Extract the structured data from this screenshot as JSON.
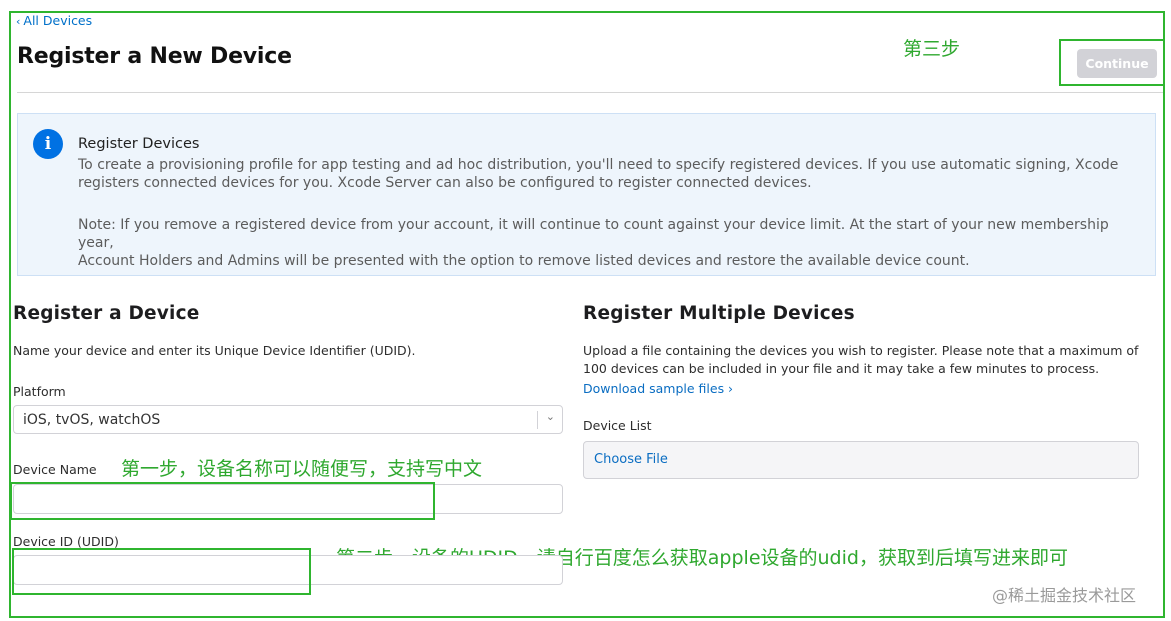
{
  "nav": {
    "back_label": "All Devices"
  },
  "header": {
    "title": "Register a New Device",
    "continue_label": "Continue"
  },
  "info": {
    "title": "Register Devices",
    "p1_line1": "To create a provisioning profile for app testing and ad hoc distribution, you'll need to specify registered devices. If you use automatic signing, Xcode",
    "p1_line2": "registers connected devices for you. Xcode Server can also be configured to register connected devices.",
    "p2_line1": "Note: If you remove a registered device from your account, it will continue to count against your device limit. At the start of your new membership year,",
    "p2_line2": "Account Holders and Admins will be presented with the option to remove listed devices and restore the available device count."
  },
  "single": {
    "title": "Register a Device",
    "description": "Name your device and enter its Unique Device Identifier (UDID).",
    "platform_label": "Platform",
    "platform_value": "iOS, tvOS, watchOS",
    "name_label": "Device Name",
    "name_value": "",
    "udid_label": "Device ID (UDID)",
    "udid_value": ""
  },
  "multiple": {
    "title": "Register Multiple Devices",
    "desc_line1": "Upload a file containing the devices you wish to register. Please note that a maximum of",
    "desc_line2": "100 devices can be included in your file and it may take a few minutes to process.",
    "download_link": "Download sample files ›",
    "list_label": "Device List",
    "choose_file": "Choose File"
  },
  "annotations": {
    "step1": "第一步，设备名称可以随便写，支持写中文",
    "step2": "第二步，设备的UDID，请自行百度怎么获取apple设备的udid，获取到后填写进来即可",
    "step3": "第三步"
  },
  "watermark": "@稀土掘金技术社区",
  "colors": {
    "annotation": "#2fb52f",
    "link": "#0070c9",
    "info_bg": "#eef5fc",
    "button_disabled": "#d2d2d7"
  }
}
